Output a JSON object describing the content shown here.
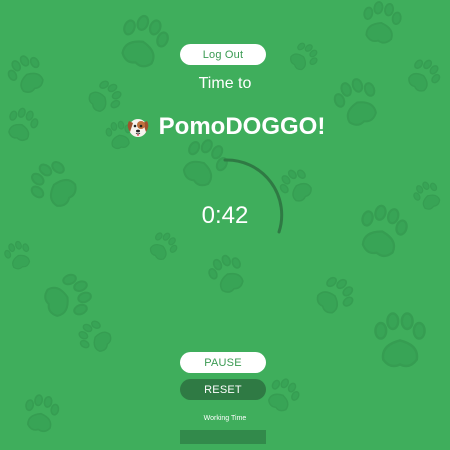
{
  "header": {
    "logout_label": "Log Out",
    "subtitle": "Time to",
    "title": "PomoDOGGO!",
    "logo_icon": "dog-face-icon"
  },
  "timer": {
    "display": "0:42",
    "mode": "Working Time"
  },
  "controls": {
    "pause_label": "PAUSE",
    "reset_label": "RESET"
  },
  "colors": {
    "background": "#3fae5c",
    "accent_dark": "#2f7a44",
    "button_light": "#ffffff",
    "button_text": "#3a9a52"
  }
}
